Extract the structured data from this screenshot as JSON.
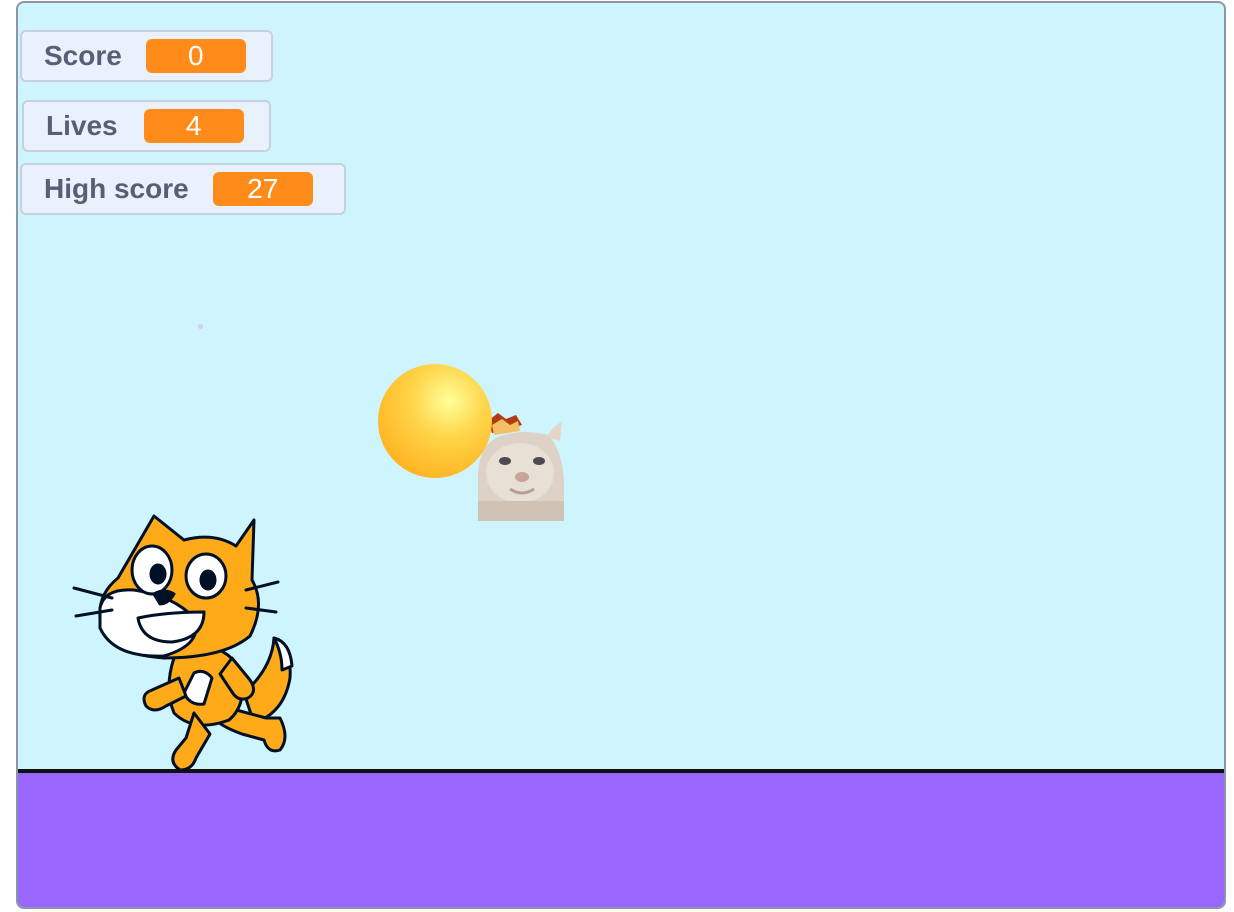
{
  "game": {
    "monitors": [
      {
        "label": "Score",
        "value": "0"
      },
      {
        "label": "Lives",
        "value": "4"
      },
      {
        "label": "High score",
        "value": "27"
      }
    ],
    "sprites": {
      "player": "scratch-cat",
      "enemy": "meme-cat",
      "projectile": "ball"
    },
    "colors": {
      "sky": "#cef5fe",
      "ground": "#9966ff",
      "monitor_value": "#ff8c1a",
      "ball": "#ffb21f"
    }
  }
}
